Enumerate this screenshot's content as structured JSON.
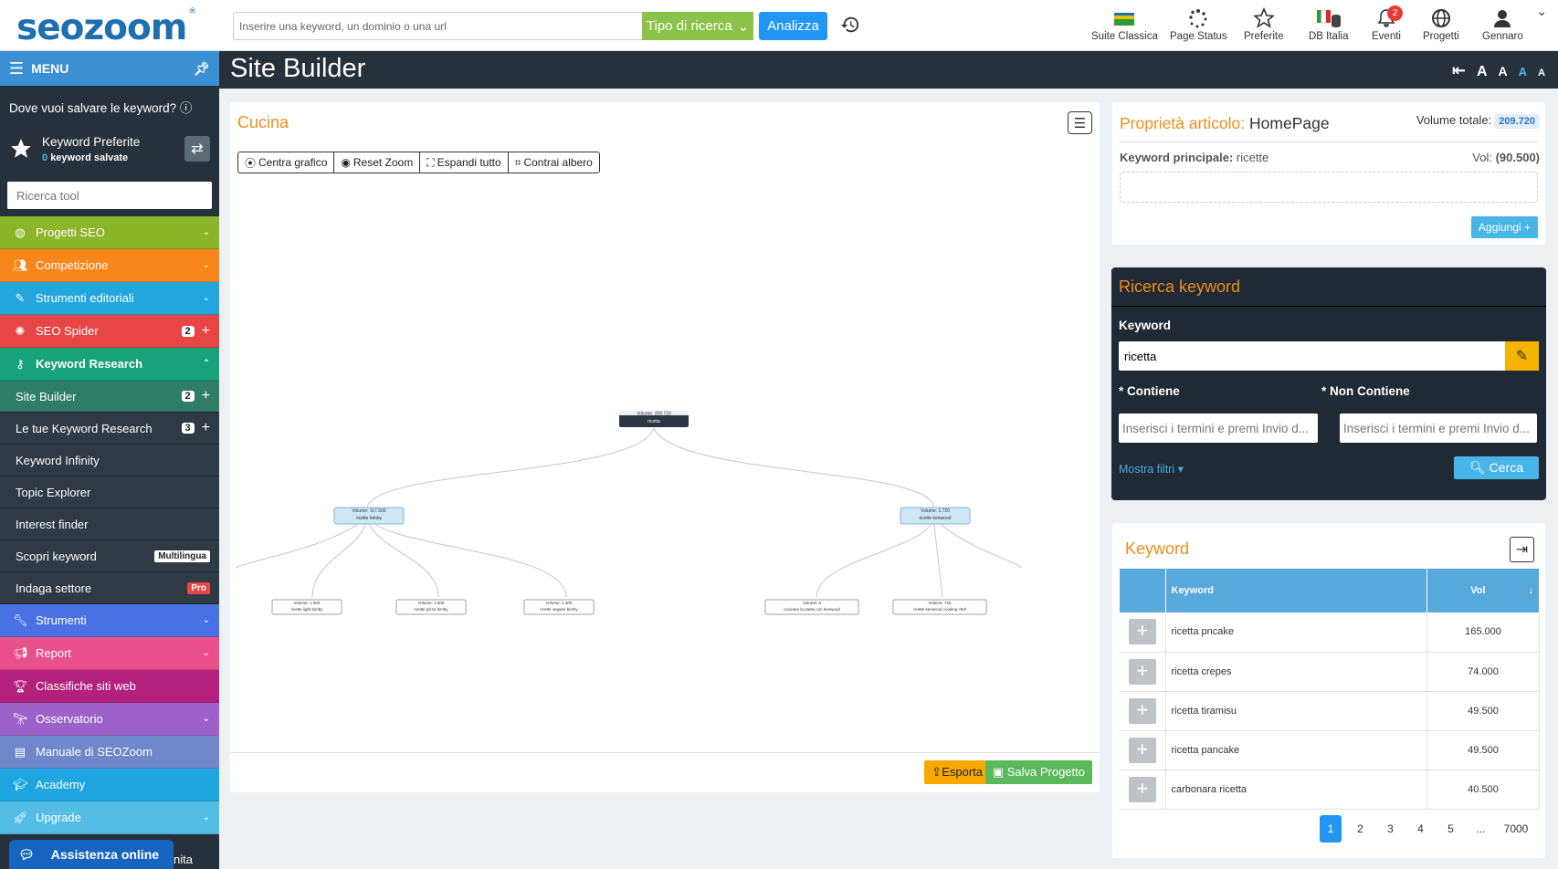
{
  "topbar": {
    "logo": "seozoom",
    "search_placeholder": "Inserire una keyword, un dominio o una url",
    "tipo_label": "Tipo di ricerca",
    "analizza_label": "Analizza",
    "nav": [
      {
        "label": "Suite Classica",
        "icon": "suite-flag-icon"
      },
      {
        "label": "Page Status",
        "icon": "page-status-icon"
      },
      {
        "label": "Preferite",
        "icon": "star-icon"
      },
      {
        "label": "DB Italia",
        "icon": "italy-db-icon"
      },
      {
        "label": "Eventi",
        "icon": "bell-icon",
        "badge": "2"
      },
      {
        "label": "Progetti",
        "icon": "globe-icon"
      },
      {
        "label": "Gennaro",
        "icon": "user-icon"
      }
    ]
  },
  "sidebar": {
    "menu_label": "MENU",
    "save_question": "Dove vuoi salvare le keyword?",
    "kw_pref_title": "Keyword Preferite",
    "kw_pref_count": "0",
    "kw_pref_suffix": "keyword salvate",
    "tool_search_placeholder": "Ricerca tool",
    "items": [
      {
        "label": "Progetti SEO",
        "color": "#8db52a",
        "icon": "globe-icon"
      },
      {
        "label": "Competizione",
        "color": "#f7861d",
        "icon": "users-icon"
      },
      {
        "label": "Strumenti editoriali",
        "color": "#22a6dc",
        "icon": "edit-icon"
      },
      {
        "label": "SEO Spider",
        "color": "#e84545",
        "icon": "bug-icon",
        "badge": "2"
      },
      {
        "label": "Keyword Research",
        "color": "#17a27a",
        "icon": "key-icon"
      }
    ],
    "sub_items": [
      {
        "label": "Site Builder",
        "badge": "2",
        "active": true
      },
      {
        "label": "Le tue Keyword Research",
        "badge": "3"
      },
      {
        "label": "Keyword Infinity"
      },
      {
        "label": "Topic Explorer"
      },
      {
        "label": "Interest finder"
      },
      {
        "label": "Scopri keyword",
        "tag": "Multilingua"
      },
      {
        "label": "Indaga settore",
        "tag": "Pro"
      }
    ],
    "items2": [
      {
        "label": "Strumenti",
        "color": "#4a71e3",
        "icon": "wrench-icon",
        "chevron": true
      },
      {
        "label": "Report",
        "color": "#e8508a",
        "icon": "megaphone-icon",
        "chevron": true
      },
      {
        "label": "Classifiche siti web",
        "color": "#b3217c",
        "icon": "trophy-icon"
      },
      {
        "label": "Osservatorio",
        "color": "#9d62c9",
        "icon": "telescope-icon",
        "chevron": true
      },
      {
        "label": "Manuale di SEOZoom",
        "color": "#7088c9",
        "icon": "book-icon"
      },
      {
        "label": "Academy",
        "color": "#1fa5e0",
        "icon": "graduation-icon"
      },
      {
        "label": "Upgrade",
        "color": "#53bde6",
        "icon": "rocket-icon",
        "chevron": true
      }
    ],
    "assist_label": "Assistenza online",
    "assist_trailing": "nita"
  },
  "page": {
    "title": "Site Builder",
    "font_sizes": [
      "A",
      "A",
      "A",
      "A"
    ]
  },
  "builder": {
    "project_name": "Cucina",
    "toolbar": [
      "Centra grafico",
      "Reset Zoom",
      "Espandi tutto",
      "Contrai albero"
    ],
    "tree": {
      "root": {
        "volume": "Volume: 209.720",
        "name": "ricetta"
      },
      "level1": [
        {
          "volume": "Volume: 117.500",
          "name": "ricette bimby"
        },
        {
          "volume": "Volume: 1.720",
          "name": "ricette kenwood"
        }
      ],
      "level2": [
        {
          "volume": "Volume: 1.000",
          "name": "ricette light bimby"
        },
        {
          "volume": "Volume: 1.600",
          "name": "ricette pizza bimby"
        },
        {
          "volume": "Volume: 1.300",
          "name": "ricette vegane bimby"
        },
        {
          "volume": "Volume: 0",
          "name": "cucinare la pasta con kenwood"
        },
        {
          "volume": "Volume: 720",
          "name": "ricette kenwood cooking chef"
        }
      ]
    },
    "esporta_label": "Esporta",
    "salva_label": "Salva Progetto"
  },
  "props": {
    "title_prefix": "Proprietà articolo:",
    "title_name": "HomePage",
    "vol_label": "Volume totale:",
    "vol_value": "209.720",
    "kw_label": "Keyword principale:",
    "kw_value": "ricette",
    "kw_vol_label": "Vol:",
    "kw_vol_value": "(90.500)",
    "aggiungi_label": "Aggiungi"
  },
  "ricerca": {
    "title": "Ricerca keyword",
    "keyword_label": "Keyword",
    "keyword_value": "ricetta",
    "contiene_label": "* Contiene",
    "non_contiene_label": "* Non Contiene",
    "contiene_placeholder": "Inserisci i termini e premi Invio d...",
    "non_contiene_placeholder": "Inserisci i termini e premi Invio d...",
    "mostra_filtri": "Mostra filtri",
    "cerca_label": "Cerca"
  },
  "keywords": {
    "title": "Keyword",
    "col_keyword": "Keyword",
    "col_vol": "Vol",
    "rows": [
      {
        "keyword": "ricetta pncake",
        "vol": "165.000"
      },
      {
        "keyword": "ricetta crepes",
        "vol": "74.000"
      },
      {
        "keyword": "ricetta tiramisu",
        "vol": "49.500"
      },
      {
        "keyword": "ricetta pancake",
        "vol": "49.500"
      },
      {
        "keyword": "carbonara ricetta",
        "vol": "40.500"
      }
    ],
    "pages": [
      "1",
      "2",
      "3",
      "4",
      "5",
      "...",
      "7000"
    ]
  }
}
